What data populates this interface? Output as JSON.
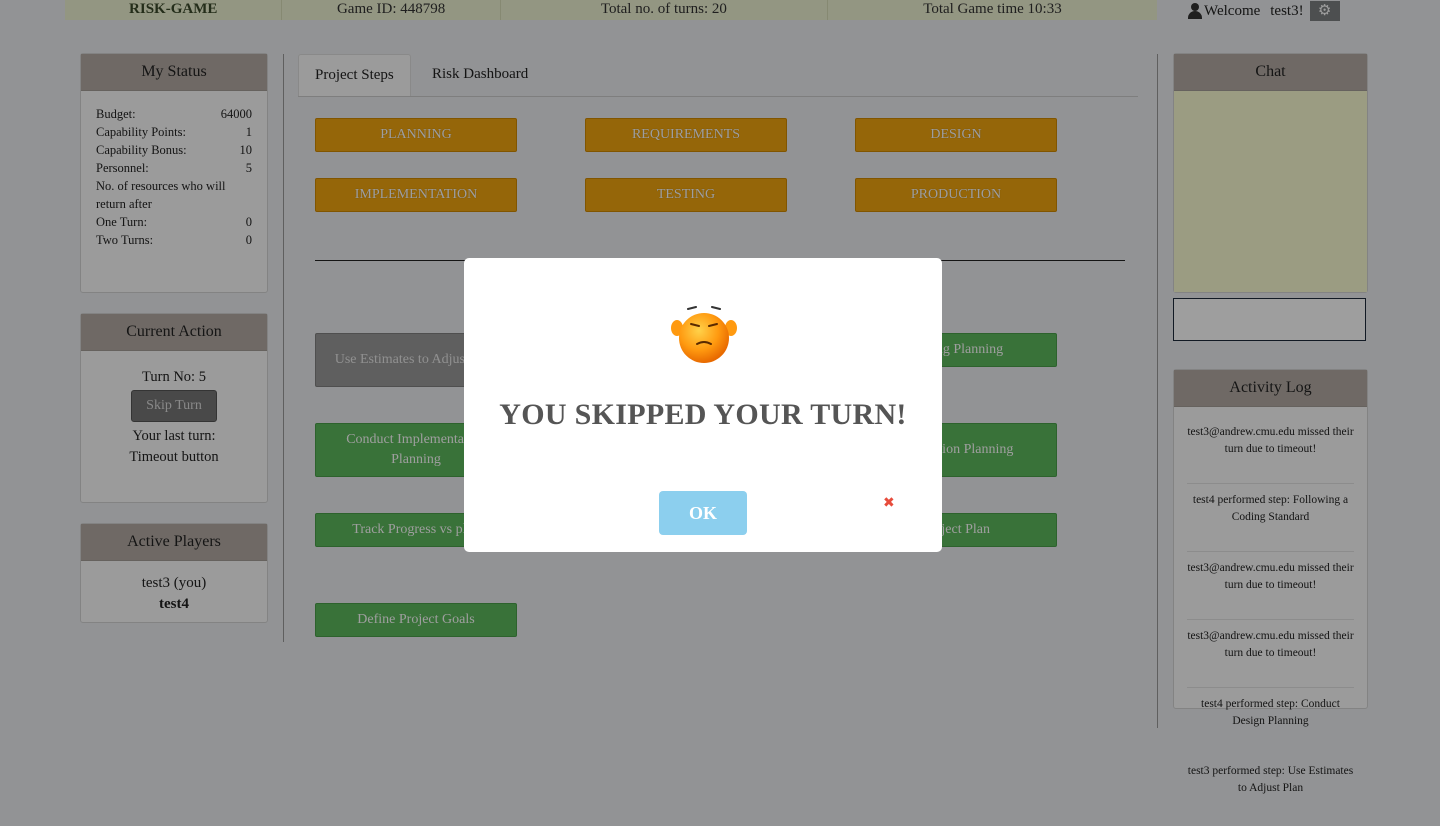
{
  "topbar": {
    "app_name": "RISK-GAME",
    "game_id": "Game ID: 448798",
    "total_turns": "Total  no. of turns:  20",
    "game_time": "Total  Game  time  10:33"
  },
  "user": {
    "welcome": "Welcome",
    "username": "test3!",
    "settings_icon": "gear-icon"
  },
  "status": {
    "title": "My Status",
    "rows": [
      {
        "label": "Budget:",
        "value": "64000"
      },
      {
        "label": "Capability  Points:",
        "value": "1"
      },
      {
        "label": "Capability  Bonus:",
        "value": "10"
      },
      {
        "label": "Personnel:",
        "value": "5"
      }
    ],
    "resources_note": "No. of resources  who will return  after",
    "rows2": [
      {
        "label": "One Turn:",
        "value": "0"
      },
      {
        "label": "Two Turns:",
        "value": "0"
      }
    ]
  },
  "current_action": {
    "title": "Current  Action",
    "turn_no": "Turn  No: 5",
    "skip_label": "Skip Turn",
    "last_turn_label": "Your  last turn:",
    "last_turn_value": "Timeout  button"
  },
  "active_players": {
    "title": "Active  Players",
    "players": [
      "test3  (you)",
      "test4"
    ]
  },
  "tabs": [
    "Project  Steps",
    "Risk  Dashboard"
  ],
  "phases": [
    "PLANNING",
    "REQUIREMENTS",
    "DESIGN",
    "IMPLEMENTATION",
    "TESTING",
    "PRODUCTION"
  ],
  "steps": {
    "use_estimates": "Use Estimates  to Adjust Plan",
    "testing_planning": "Testing  Planning",
    "conduct_impl": "Conduct  Implementation Planning",
    "production_planning": "Production Planning",
    "track_progress": "Track Progress  vs plan",
    "project_plan": "Project Plan",
    "define_goals": "Define  Project  Goals"
  },
  "chat": {
    "title": "Chat"
  },
  "activity_log": {
    "title": "Activity  Log",
    "entries": [
      "test3@andrew.cmu.edu    missed their  turn  due  to timeout!",
      "test4  performed  step: Following  a Coding  Standard",
      "test3@andrew.cmu.edu    missed their  turn  due  to timeout!",
      "test3@andrew.cmu.edu    missed their  turn  due  to timeout!",
      "test4  performed  step:  Conduct Design  Planning",
      "test3  performed  step:  Use Estimates  to Adjust  Plan"
    ]
  },
  "modal": {
    "title": "YOU SKIPPED YOUR TURN!",
    "ok_label": "OK",
    "close_glyph": "✖"
  },
  "colors": {
    "phase": "#f0a50f",
    "step": "#5cb85c",
    "ok_button": "#8ccfee",
    "chat_bg": "#fbfcd2",
    "panel_header": "#b3aaa3"
  }
}
